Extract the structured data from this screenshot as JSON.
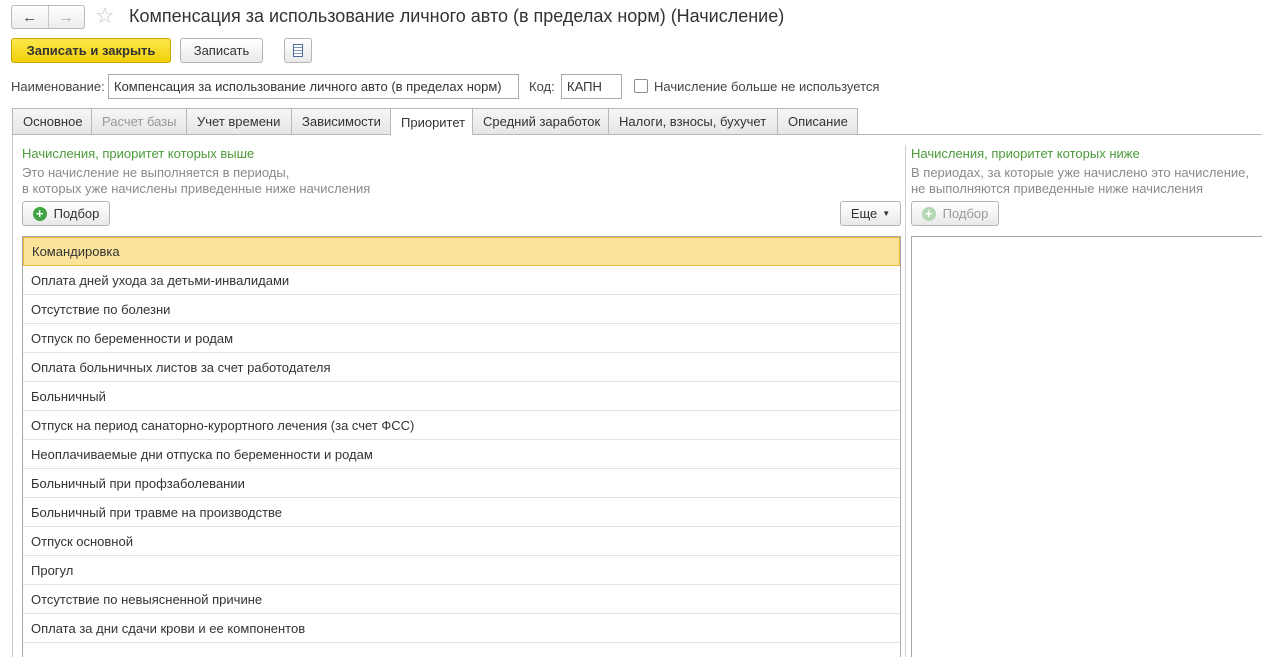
{
  "nav": {
    "back_glyph": "←",
    "forward_glyph": "→",
    "star_glyph": "☆"
  },
  "window": {
    "title": "Компенсация за использование личного авто (в пределах норм) (Начисление)"
  },
  "toolbar": {
    "save_close_label": "Записать и закрыть",
    "save_label": "Записать"
  },
  "form": {
    "name_label": "Наименование:",
    "name_value": "Компенсация за использование личного авто (в пределах норм)",
    "code_label": "Код:",
    "code_value": "КАПН",
    "unused_label": "Начисление больше не используется",
    "unused_checked": false
  },
  "tabs": [
    {
      "label": "Основное",
      "state": "normal"
    },
    {
      "label": "Расчет базы",
      "state": "disabled"
    },
    {
      "label": "Учет времени",
      "state": "normal"
    },
    {
      "label": "Зависимости",
      "state": "normal"
    },
    {
      "label": "Приоритет",
      "state": "active"
    },
    {
      "label": "Средний заработок",
      "state": "normal"
    },
    {
      "label": "Налоги, взносы, бухучет",
      "state": "normal"
    },
    {
      "label": "Описание",
      "state": "normal"
    }
  ],
  "left_panel": {
    "heading": "Начисления, приоритет которых выше",
    "desc_line1": "Это начисление не выполняется в периоды,",
    "desc_line2": "в которых уже начислены приведенные ниже начисления",
    "pick_label": "Подбор",
    "more_label": "Еще",
    "items": [
      "Командировка",
      "Оплата дней ухода за детьми-инвалидами",
      "Отсутствие по болезни",
      "Отпуск по беременности и родам",
      "Оплата больничных листов за счет работодателя",
      "Больничный",
      "Отпуск на период санаторно-курортного лечения (за счет ФСС)",
      "Неоплачиваемые дни отпуска по беременности и родам",
      "Больничный при профзаболевании",
      "Больничный при травме на производстве",
      "Отпуск основной",
      "Прогул",
      "Отсутствие по невыясненной причине",
      "Оплата за дни сдачи крови и ее компонентов"
    ],
    "selected_index": 0
  },
  "right_panel": {
    "heading": "Начисления, приоритет которых ниже",
    "desc_line1": "В периодах, за которые уже начислено это начисление,",
    "desc_line2": "не выполняются приведенные ниже начисления",
    "pick_label": "Подбор"
  },
  "colors": {
    "accent_yellow": "#f5d61d",
    "selection": "#fbe39a",
    "green_heading": "#4c9a3a"
  },
  "icons": [
    "back-arrow-icon",
    "forward-arrow-icon",
    "star-icon",
    "document-list-icon",
    "plus-circle-icon",
    "dropdown-caret-icon"
  ]
}
